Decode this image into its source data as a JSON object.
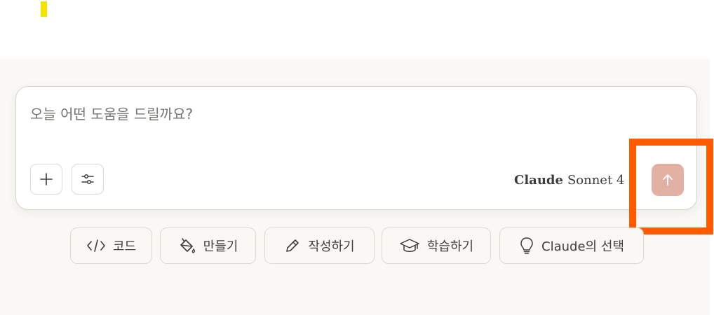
{
  "composer": {
    "placeholder": "오늘 어떤 도움을 드릴까요?",
    "add_icon": "plus-icon",
    "tools_icon": "sliders-icon",
    "model": {
      "brand": "Claude",
      "name": "Sonnet 4",
      "icon": "chevron-down-icon"
    },
    "send_icon": "arrow-up-icon",
    "send_color": "#e3b1a3"
  },
  "highlight_color": "#ff5a00",
  "chips": [
    {
      "label": "코드",
      "icon": "code-icon"
    },
    {
      "label": "만들기",
      "icon": "paint-bucket-icon"
    },
    {
      "label": "작성하기",
      "icon": "pencil-icon"
    },
    {
      "label": "학습하기",
      "icon": "graduation-cap-icon"
    },
    {
      "label": "Claude의 선택",
      "icon": "lightbulb-icon"
    }
  ]
}
